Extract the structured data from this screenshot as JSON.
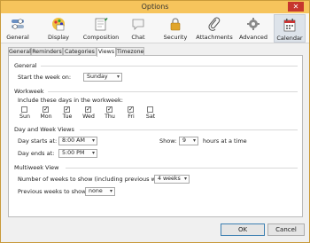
{
  "window": {
    "title": "Options",
    "close_symbol": "✕"
  },
  "toolbar": [
    {
      "label": "General",
      "icon": "settings-switches-icon"
    },
    {
      "label": "Display",
      "icon": "display-palette-icon"
    },
    {
      "label": "Composition",
      "icon": "composition-pencil-icon"
    },
    {
      "label": "Chat",
      "icon": "chat-bubble-icon"
    },
    {
      "label": "Security",
      "icon": "padlock-icon"
    },
    {
      "label": "Attachments",
      "icon": "paperclip-icon"
    },
    {
      "label": "Advanced",
      "icon": "gear-icon"
    },
    {
      "label": "Calendar",
      "icon": "calendar-icon",
      "selected": true
    }
  ],
  "tabs": [
    {
      "label": "General"
    },
    {
      "label": "Reminders"
    },
    {
      "label": "Categories"
    },
    {
      "label": "Views",
      "active": true
    },
    {
      "label": "Timezone"
    }
  ],
  "general": {
    "title": "General",
    "start_week_label": "Start the week on:",
    "start_week_value": "Sunday"
  },
  "workweek": {
    "title": "Workweek",
    "include_label": "Include these days in the workweek:",
    "days": [
      {
        "label": "Sun",
        "checked": false
      },
      {
        "label": "Mon",
        "checked": true
      },
      {
        "label": "Tue",
        "checked": true
      },
      {
        "label": "Wed",
        "checked": true
      },
      {
        "label": "Thu",
        "checked": true
      },
      {
        "label": "Fri",
        "checked": true
      },
      {
        "label": "Sat",
        "checked": false
      }
    ]
  },
  "dayweek": {
    "title": "Day and Week Views",
    "day_starts_label": "Day starts at:",
    "day_starts_value": "8:00 AM",
    "day_ends_label": "Day ends at:",
    "day_ends_value": "5:00 PM",
    "show_label": "Show:",
    "show_value": "9",
    "hours_label": "hours at a time"
  },
  "multiweek": {
    "title": "Multiweek View",
    "num_weeks_label": "Number of weeks to show (including previous weeks):",
    "num_weeks_value": "4 weeks",
    "prev_weeks_label": "Previous weeks to show:",
    "prev_weeks_value": "none"
  },
  "buttons": {
    "ok": "OK",
    "cancel": "Cancel"
  },
  "colors": {
    "titlebar": "#f6c45c",
    "close": "#c7362d",
    "accent": "#3c7fb1"
  }
}
